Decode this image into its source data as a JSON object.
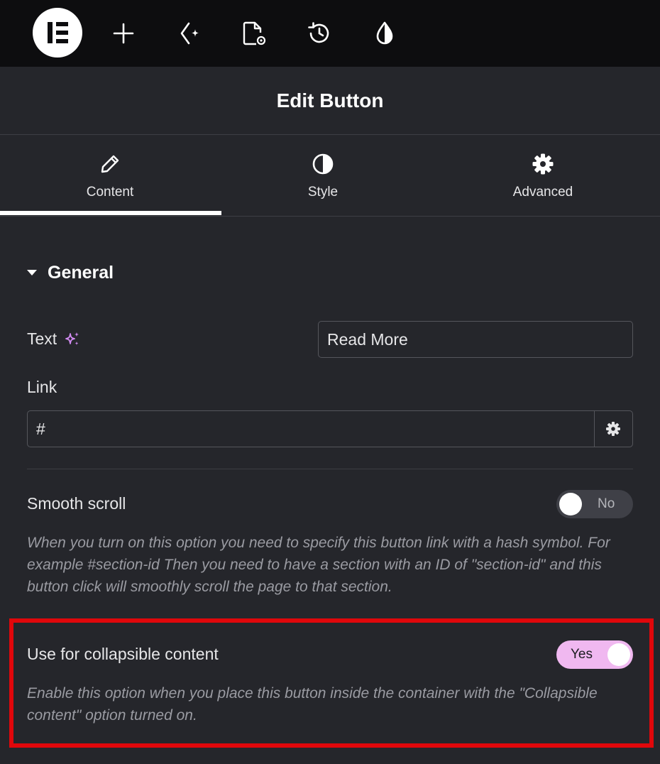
{
  "colors": {
    "topbar_bg": "#0d0d0f",
    "panel_bg": "#25262b",
    "accent_pink": "#f0b8f0",
    "ai_sparkle": "#d28bf2",
    "highlight_border": "#e0070b",
    "description_text": "#9a9ba2"
  },
  "topbar": {
    "icons": [
      "elementor-logo",
      "plus-icon",
      "ai-sparkle-icon",
      "page-settings-icon",
      "history-icon",
      "site-settings-icon"
    ]
  },
  "header": {
    "title": "Edit Button"
  },
  "tabs": [
    {
      "label": "Content",
      "icon": "pencil-icon",
      "active": true
    },
    {
      "label": "Style",
      "icon": "contrast-icon",
      "active": false
    },
    {
      "label": "Advanced",
      "icon": "gear-icon",
      "active": false
    }
  ],
  "section": {
    "title": "General",
    "expanded": true
  },
  "fields": {
    "text": {
      "label": "Text",
      "value": "Read More"
    },
    "link": {
      "label": "Link",
      "value": "#"
    },
    "smooth_scroll": {
      "label": "Smooth scroll",
      "toggle_label": "No",
      "enabled": false,
      "description": "When you turn on this option you need to specify this button link with a hash symbol. For example #section-id Then you need to have a section with an ID of \"section-id\" and this button click will smoothly scroll the page to that section."
    },
    "collapsible": {
      "label": "Use for collapsible content",
      "toggle_label": "Yes",
      "enabled": true,
      "description": "Enable this option when you place this button inside the container with the \"Collapsible content\" option turned on."
    }
  }
}
